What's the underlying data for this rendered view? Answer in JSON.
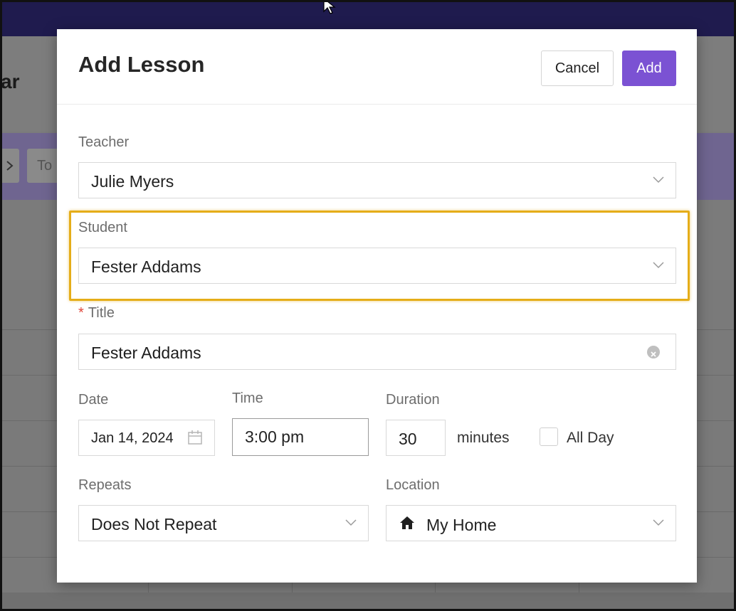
{
  "background": {
    "page_title_fragment": "ar",
    "toolbar_button_fragment": "To"
  },
  "modal": {
    "title": "Add Lesson",
    "cancel_label": "Cancel",
    "add_label": "Add"
  },
  "form": {
    "teacher": {
      "label": "Teacher",
      "value": "Julie Myers"
    },
    "student": {
      "label": "Student",
      "value": "Fester Addams"
    },
    "title": {
      "required_mark": "*",
      "label": "Title",
      "value": "Fester Addams"
    },
    "date": {
      "label": "Date",
      "value": "Jan 14, 2024"
    },
    "time": {
      "label": "Time",
      "value": "3:00 pm"
    },
    "duration": {
      "label": "Duration",
      "value": "30",
      "unit": "minutes"
    },
    "all_day": {
      "label": "All Day",
      "checked": false
    },
    "repeats": {
      "label": "Repeats",
      "value": "Does Not Repeat"
    },
    "location": {
      "label": "Location",
      "value": "My Home",
      "icon": "home-icon"
    }
  },
  "colors": {
    "accent": "#7b52d3",
    "highlight": "#e5ad19",
    "required": "#e0473c"
  }
}
